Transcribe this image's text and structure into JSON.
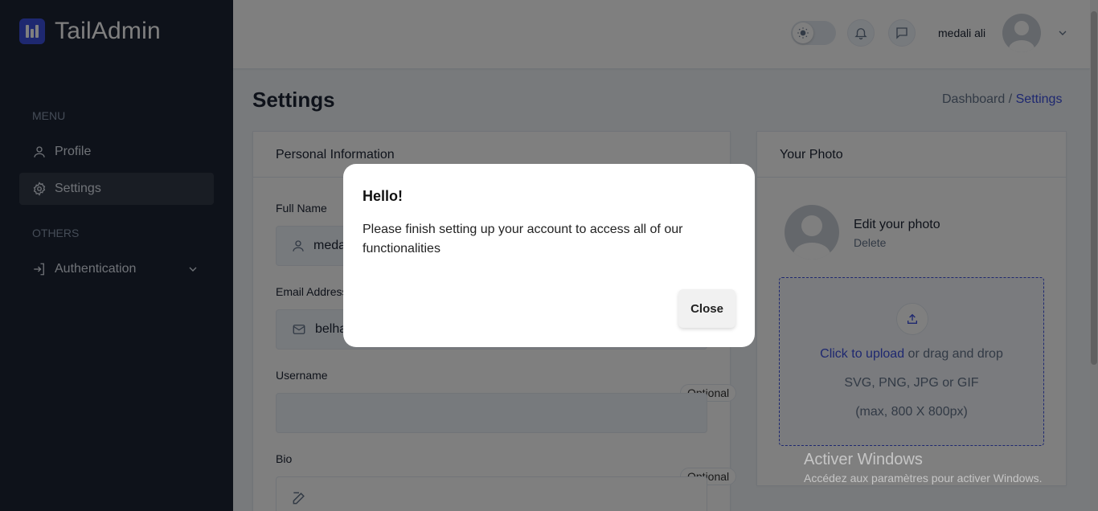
{
  "brand": {
    "name": "TailAdmin",
    "accent": "#3c50e0",
    "sidebar_bg": "#1c2434"
  },
  "sidebar": {
    "menu_heading": "MENU",
    "others_heading": "OTHERS",
    "items": [
      {
        "label": "Profile",
        "icon": "user-icon",
        "active": false
      },
      {
        "label": "Settings",
        "icon": "gear-icon",
        "active": true
      },
      {
        "label": "Authentication",
        "icon": "login-icon",
        "active": false,
        "expandable": true
      }
    ]
  },
  "header": {
    "theme_toggle_icon": "sun-icon",
    "notification_icon": "bell-icon",
    "messages_icon": "chat-icon",
    "user_name": "medali ali",
    "user_menu_icon": "chevron-down-icon"
  },
  "page": {
    "title": "Settings",
    "breadcrumb": {
      "parent": "Dashboard /",
      "current": "Settings"
    }
  },
  "personal_info": {
    "title": "Personal Information",
    "full_name": {
      "label": "Full Name",
      "value": "meda",
      "icon": "user-icon"
    },
    "email": {
      "label": "Email Address",
      "value": "belha",
      "icon": "mail-icon"
    },
    "username": {
      "label": "Username",
      "value": "",
      "badge": "Optional"
    },
    "bio": {
      "label": "Bio",
      "value": "",
      "badge": "Optional",
      "icon": "edit-icon"
    }
  },
  "photo": {
    "title": "Your Photo",
    "edit_label": "Edit your photo",
    "delete_label": "Delete",
    "upload_link": "Click to upload",
    "upload_rest": " or drag and drop",
    "formats": "SVG, PNG, JPG or GIF",
    "max_size": "(max, 800 X 800px)"
  },
  "watermark": {
    "title": "Activer Windows",
    "subtitle": "Accédez aux paramètres pour activer Windows."
  },
  "modal": {
    "title": "Hello!",
    "body": "Please finish setting up your account to access all of our functionalities",
    "close_label": "Close"
  }
}
